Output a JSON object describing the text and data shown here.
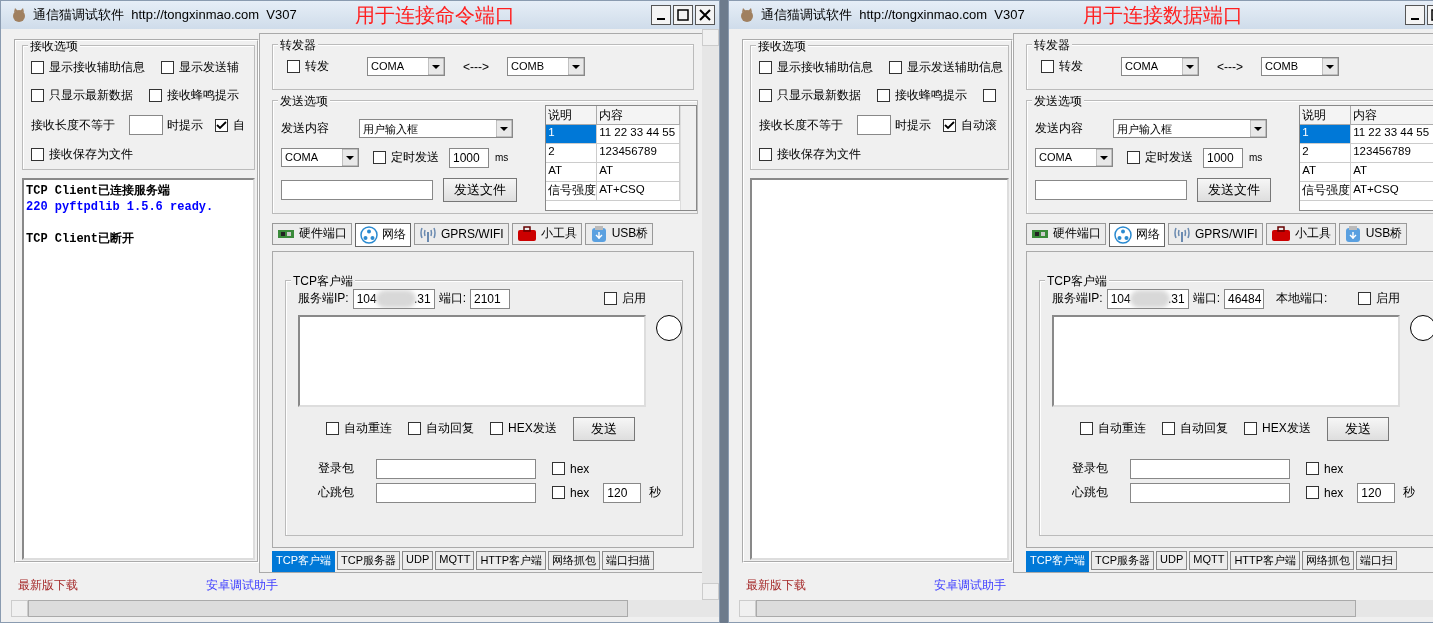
{
  "windows": [
    {
      "title": "通信猫调试软件  http://tongxinmao.com  V307",
      "annotation": "用于连接命令端口",
      "receive_options": {
        "title": "接收选项",
        "rows": [
          [
            {
              "kind": "checkbox",
              "label": "显示接收辅助信息",
              "checked": false
            },
            {
              "kind": "checkbox",
              "label": "显示发送辅",
              "checked": false
            }
          ],
          [
            {
              "kind": "checkbox",
              "label": "只显示最新数据",
              "checked": false
            },
            {
              "kind": "checkbox",
              "label": "接收蜂鸣提示",
              "checked": false
            }
          ],
          [
            {
              "kind": "label",
              "label": "接收长度不等于"
            },
            {
              "kind": "input"
            },
            {
              "kind": "label",
              "label": "时提示"
            },
            {
              "kind": "checkbox",
              "label": "自",
              "checked": true
            }
          ],
          [
            {
              "kind": "checkbox",
              "label": "接收保存为文件",
              "checked": false
            }
          ]
        ]
      },
      "log": [
        {
          "kind": "text",
          "text": "TCP Client已连接服务端",
          "color": "#000000"
        },
        {
          "kind": "text",
          "text": "220 pyftpdlib 1.5.6 ready.",
          "color": "#0000ff"
        },
        {
          "kind": "blank"
        },
        {
          "kind": "text",
          "text": "TCP Client已断开",
          "color": "#000000"
        }
      ],
      "forwarder": {
        "title": "转发器",
        "checkbox": {
          "label": "转发",
          "checked": false
        },
        "port_a": "COMA",
        "arrow": "<--->",
        "port_b": "COMB"
      },
      "send_options": {
        "title": "发送选项",
        "content_label": "发送内容",
        "content_select": "用户输入框",
        "port_select": "COMA",
        "timer": {
          "label": "定时发送",
          "checked": false
        },
        "interval": "1000",
        "unit": "ms",
        "file_button": "发送文件",
        "table": {
          "columns": [
            "说明",
            "内容"
          ],
          "rows": [
            {
              "cells": [
                "1",
                "11 22 33 44 55"
              ],
              "selected": true
            },
            {
              "cells": [
                "2",
                "123456789"
              ],
              "selected": false
            },
            {
              "cells": [
                "AT",
                "AT"
              ],
              "selected": false
            },
            {
              "cells": [
                "信号强度",
                "AT+CSQ"
              ],
              "selected": false
            }
          ]
        }
      },
      "tabs": [
        {
          "label": "硬件端口",
          "kind": "board",
          "selected": false
        },
        {
          "label": "网络",
          "kind": "network",
          "selected": true
        },
        {
          "label": "GPRS/WIFI",
          "kind": "antenna",
          "selected": false
        },
        {
          "label": "小工具",
          "kind": "toolbox",
          "selected": false
        },
        {
          "label": "USB桥",
          "kind": "usb",
          "selected": false
        }
      ],
      "tcp_client": {
        "title": "TCP客户端",
        "server_ip_label": "服务端IP:",
        "server_ip": "104",
        "server_ip_end": ".31",
        "port_label": "端口:",
        "port": "2101",
        "enable": {
          "label": "启用",
          "checked": false
        },
        "options": [
          {
            "label": "自动重连",
            "checked": false
          },
          {
            "label": "自动回复",
            "checked": false
          },
          {
            "label": "HEX发送",
            "checked": false
          }
        ],
        "send_button": "发送",
        "login_label": "登录包",
        "login_hex": {
          "label": "hex",
          "checked": false
        },
        "heartbeat_label": "心跳包",
        "heartbeat_hex": {
          "label": "hex",
          "checked": false
        },
        "heartbeat_interval": "120",
        "heartbeat_unit": "秒"
      },
      "bottom_tabs": [
        {
          "label": "TCP客户端",
          "selected": true
        },
        {
          "label": "TCP服务器",
          "selected": false
        },
        {
          "label": "UDP",
          "selected": false
        },
        {
          "label": "MQTT",
          "selected": false
        },
        {
          "label": "HTTP客户端",
          "selected": false
        },
        {
          "label": "网络抓包",
          "selected": false
        },
        {
          "label": "端口扫描",
          "selected": false
        }
      ],
      "links": [
        {
          "text": "最新版下载"
        },
        {
          "text": "安卓调试助手"
        }
      ]
    },
    {
      "title": "通信猫调试软件  http://tongxinmao.com  V307",
      "annotation": "用于连接数据端口",
      "receive_options": {
        "title": "接收选项",
        "rows": [
          [
            {
              "kind": "checkbox",
              "label": "显示接收辅助信息",
              "checked": false
            },
            {
              "kind": "checkbox",
              "label": "显示发送辅助信息",
              "checked": false
            }
          ],
          [
            {
              "kind": "checkbox",
              "label": "只显示最新数据",
              "checked": false
            },
            {
              "kind": "checkbox",
              "label": "接收蜂鸣提示",
              "checked": false
            },
            {
              "kind": "checkbox",
              "checked": false
            }
          ],
          [
            {
              "kind": "label",
              "label": "接收长度不等于"
            },
            {
              "kind": "input"
            },
            {
              "kind": "label",
              "label": "时提示"
            },
            {
              "kind": "checkbox",
              "label": "自动滚",
              "checked": true
            }
          ],
          [
            {
              "kind": "checkbox",
              "label": "接收保存为文件",
              "checked": false
            }
          ]
        ]
      },
      "forwarder": {
        "title": "转发器",
        "checkbox": {
          "label": "转发",
          "checked": false
        },
        "port_a": "COMA",
        "arrow": "<--->",
        "port_b": "COMB"
      },
      "send_options": {
        "title": "发送选项",
        "content_label": "发送内容",
        "content_select": "用户输入框",
        "port_select": "COMA",
        "timer": {
          "label": "定时发送",
          "checked": false
        },
        "interval": "1000",
        "unit": "ms",
        "file_button": "发送文件",
        "table": {
          "columns": [
            "说明",
            "内容"
          ],
          "rows": [
            {
              "cells": [
                "1",
                "11 22 33 44 55"
              ],
              "selected": true
            },
            {
              "cells": [
                "2",
                "123456789"
              ],
              "selected": false
            },
            {
              "cells": [
                "AT",
                "AT"
              ],
              "selected": false
            },
            {
              "cells": [
                "信号强度",
                "AT+CSQ"
              ],
              "selected": false
            }
          ]
        }
      },
      "tabs": [
        {
          "label": "硬件端口",
          "kind": "board",
          "selected": false
        },
        {
          "label": "网络",
          "kind": "network",
          "selected": true
        },
        {
          "label": "GPRS/WIFI",
          "kind": "antenna",
          "selected": false
        },
        {
          "label": "小工具",
          "kind": "toolbox",
          "selected": false
        },
        {
          "label": "USB桥",
          "kind": "usb",
          "selected": false
        }
      ],
      "tcp_client": {
        "title": "TCP客户端",
        "server_ip_label": "服务端IP:",
        "server_ip": "104",
        "server_ip_end": ".31",
        "port_label": "端口:",
        "port": "46484",
        "local_port_label": "本地端口:",
        "enable": {
          "label": "启用",
          "checked": false
        },
        "options": [
          {
            "label": "自动重连",
            "checked": false
          },
          {
            "label": "自动回复",
            "checked": false
          },
          {
            "label": "HEX发送",
            "checked": false
          }
        ],
        "send_button": "发送",
        "login_label": "登录包",
        "login_hex": {
          "label": "hex",
          "checked": false
        },
        "heartbeat_label": "心跳包",
        "heartbeat_hex": {
          "label": "hex",
          "checked": false
        },
        "heartbeat_interval": "120",
        "heartbeat_unit": "秒"
      },
      "bottom_tabs": [
        {
          "label": "TCP客户端",
          "selected": true
        },
        {
          "label": "TCP服务器",
          "selected": false
        },
        {
          "label": "UDP",
          "selected": false
        },
        {
          "label": "MQTT",
          "selected": false
        },
        {
          "label": "HTTP客户端",
          "selected": false
        },
        {
          "label": "网络抓包",
          "selected": false
        },
        {
          "label": "端口扫",
          "selected": false
        }
      ],
      "links": [
        {
          "text": "最新版下载"
        },
        {
          "text": "安卓调试助手"
        }
      ]
    }
  ]
}
